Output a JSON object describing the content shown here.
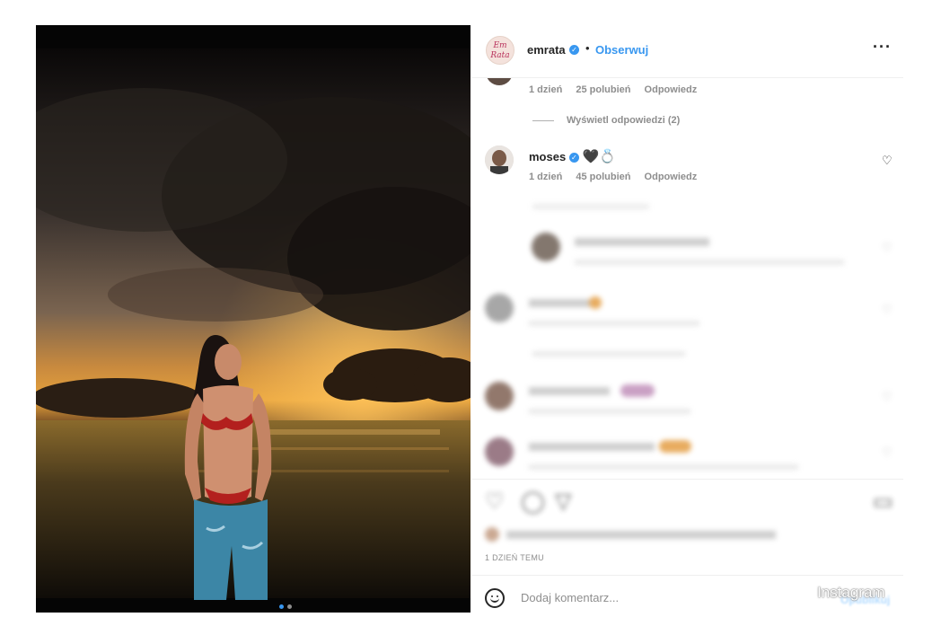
{
  "post": {
    "username": "emrata",
    "avatar_text_top": "Em",
    "avatar_text_bottom": "Rata",
    "separator": "•",
    "follow_label": "Obserwuj",
    "more_icon": "more-horizontal-icon",
    "carousel": {
      "next_icon": "chevron-right-icon",
      "slide_count": 2,
      "active_index": 0
    }
  },
  "comments": {
    "first_meta": {
      "age": "1 dzień",
      "likes": "25 polubień",
      "reply": "Odpowiedz"
    },
    "view_replies_1": "Wyświetl odpowiedzi (2)",
    "moses": {
      "username": "moses",
      "emoji": "🖤💍",
      "age": "1 dzień",
      "likes": "45 polubień",
      "reply": "Odpowiedz"
    }
  },
  "actions": {
    "like_icon": "heart-outline-icon",
    "comment_icon": "comment-icon",
    "share_icon": "share-icon",
    "save_icon": "bookmark-icon",
    "time_label": "1 DZIEŃ TEMU"
  },
  "add_comment": {
    "placeholder": "Dodaj komentarz...",
    "emoji_icon": "smile-icon",
    "post_label": "Opublikuj"
  },
  "watermark": "Instagram",
  "colors": {
    "accent": "#3897f0",
    "text": "#262626",
    "muted": "#8e8e8e",
    "border": "#efefef"
  }
}
